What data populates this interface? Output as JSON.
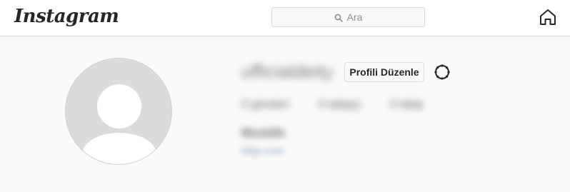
{
  "header": {
    "logo_text": "Instagram",
    "search": {
      "placeholder": "Ara",
      "icon": "search-icon"
    },
    "home_icon": "home-icon"
  },
  "profile": {
    "username": "ufficialdeity",
    "edit_button_label": "Profili Düzenle",
    "settings_icon": "gear-icon",
    "stats": {
      "posts": "0 gönderi",
      "followers": "0 takipçi",
      "following": "0 takip"
    },
    "full_name": "Mustafa",
    "website": "bilgi.com"
  },
  "colors": {
    "accent": "#262626",
    "border": "#dbdbdb",
    "background": "#fafafa",
    "avatar_placeholder": "#dbdbdb"
  }
}
